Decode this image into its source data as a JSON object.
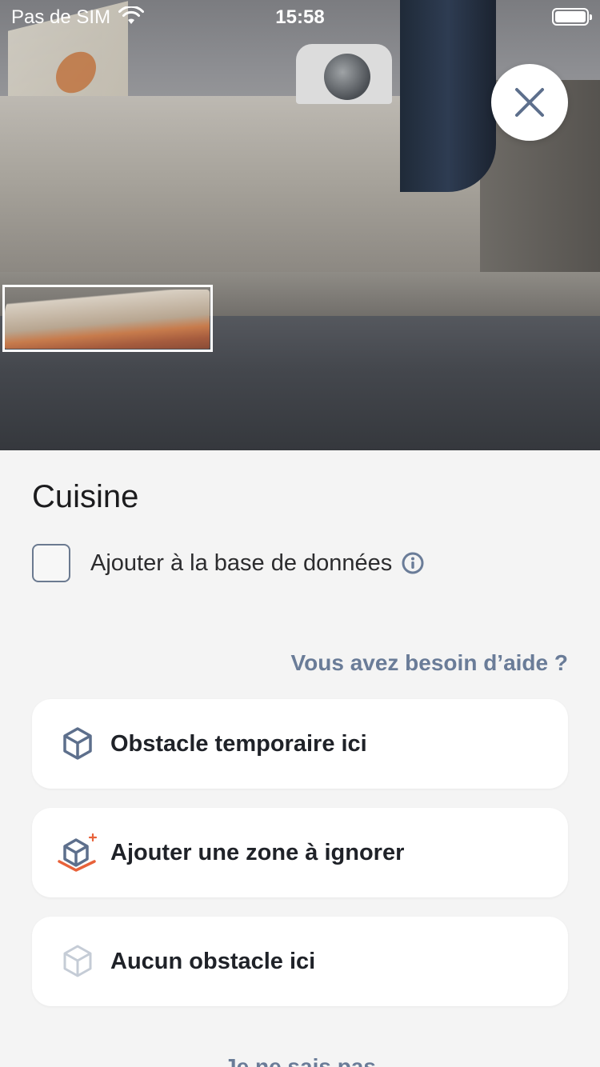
{
  "status_bar": {
    "carrier": "Pas de SIM",
    "time": "15:58"
  },
  "room": {
    "title": "Cuisine"
  },
  "database": {
    "label": "Ajouter à la base de données",
    "checked": false
  },
  "help_link": "Vous avez besoin d’aide ?",
  "options": [
    {
      "label": "Obstacle temporaire ici",
      "icon": "cube-icon"
    },
    {
      "label": "Ajouter une zone à ignorer",
      "icon": "cube-add-zone-icon"
    },
    {
      "label": "Aucun obstacle ici",
      "icon": "cube-outline-icon"
    }
  ],
  "footer_link": "Je ne sais pas",
  "colors": {
    "accent": "#6a7c98",
    "icon_blue": "#5d6f8c",
    "zone_orange": "#e8623a",
    "background": "#f4f4f4"
  }
}
